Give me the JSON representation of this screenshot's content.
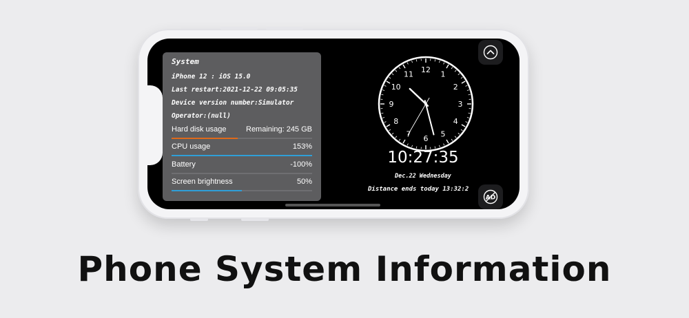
{
  "panel": {
    "title": "System",
    "device": "iPhone 12 : iOS 15.0",
    "last_restart": "Last restart:2021-12-22 09:05:35",
    "device_version": "Device version number:Simulator",
    "operator": "Operator:(null)"
  },
  "metrics": [
    {
      "label": "Hard disk usage",
      "value": "Remaining: 245 GB",
      "fill": 0.47,
      "color": "#e06a1a"
    },
    {
      "label": "CPU usage",
      "value": "153%",
      "fill": 1.0,
      "color": "#2f9fd8"
    },
    {
      "label": "Battery",
      "value": "-100%",
      "fill": 0,
      "color": "#2f9fd8"
    },
    {
      "label": "Screen brightness",
      "value": "50%",
      "fill": 0.5,
      "color": "#2f9fd8"
    }
  ],
  "clock": {
    "numbers": [
      "12",
      "1",
      "2",
      "3",
      "4",
      "5",
      "6",
      "7",
      "8",
      "9",
      "10",
      "11"
    ],
    "time": "10:27:35",
    "date": "Dec.22 Wednesday",
    "countdown": "Distance ends today 13:32:2"
  },
  "buttons": {
    "collapse_icon": "chevron-up-icon",
    "ad_icon": "no-ads-icon",
    "ad_label": "AD"
  },
  "headline": "Phone System Information"
}
